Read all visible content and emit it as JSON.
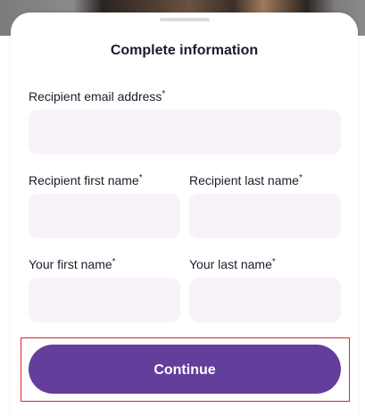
{
  "sheet": {
    "title": "Complete information"
  },
  "form": {
    "recipient_email": {
      "label": "Recipient email address",
      "required_mark": "*",
      "value": ""
    },
    "recipient_first_name": {
      "label": "Recipient first name",
      "required_mark": "*",
      "value": ""
    },
    "recipient_last_name": {
      "label": "Recipient last name",
      "required_mark": "*",
      "value": ""
    },
    "your_first_name": {
      "label": "Your first name",
      "required_mark": "*",
      "value": ""
    },
    "your_last_name": {
      "label": "Your last name",
      "required_mark": "*",
      "value": ""
    }
  },
  "actions": {
    "continue_label": "Continue"
  },
  "colors": {
    "primary": "#643e9b",
    "input_background": "#f7f3f8",
    "highlight_border": "#e0232e"
  }
}
